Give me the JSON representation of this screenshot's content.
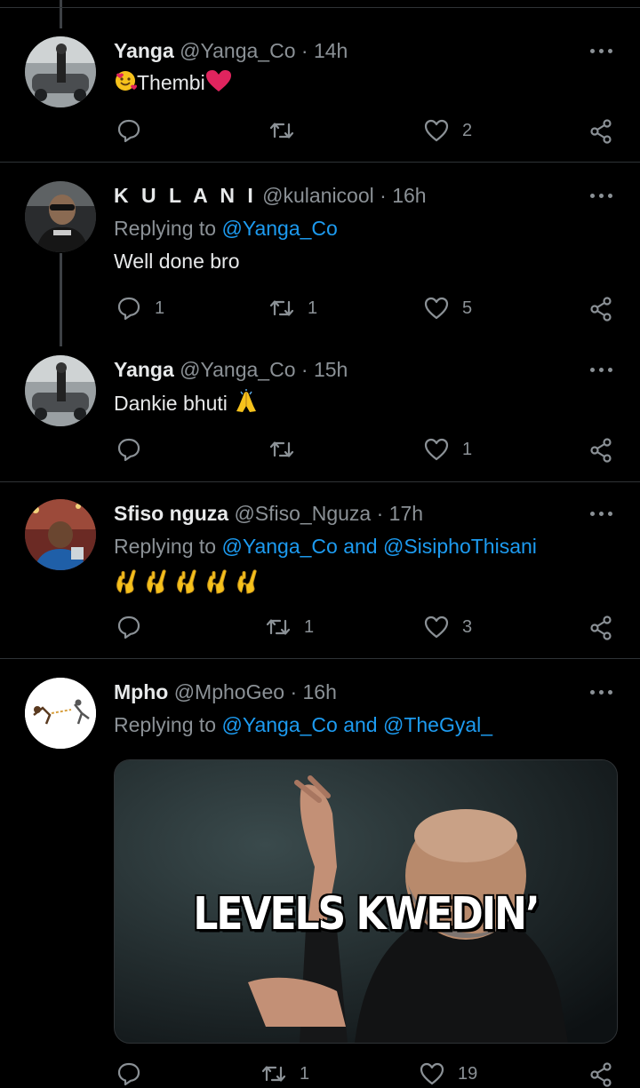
{
  "tweets": [
    {
      "name": "Yanga",
      "handle": "@Yanga_Co",
      "separator": "·",
      "time": "14h",
      "text": "Thembi",
      "leading_emoji": "smiling-face-with-hearts-icon",
      "trailing_emoji": "red-heart-icon",
      "replies": "",
      "retweets": "",
      "likes": "2"
    },
    {
      "name": "K U L A N I",
      "handle": "@kulanicool",
      "separator": "·",
      "time": "16h",
      "replying_prefix": "Replying to",
      "replying_to": [
        "@Yanga_Co"
      ],
      "text": "Well done bro",
      "replies": "1",
      "retweets": "1",
      "likes": "5"
    },
    {
      "name": "Yanga",
      "handle": "@Yanga_Co",
      "separator": "·",
      "time": "15h",
      "text": "Dankie bhuti",
      "trailing_emoji": "folded-hands-icon",
      "replies": "",
      "retweets": "",
      "likes": "1"
    },
    {
      "name": "Sfiso nguza",
      "handle": "@Sfiso_Nguza",
      "separator": "·",
      "time": "17h",
      "replying_prefix": "Replying to",
      "replying_to": [
        "@Yanga_Co",
        "@SisiphoThisani"
      ],
      "replying_conj": "and",
      "text_emoji": "ok-hand-icon x5",
      "replies": "",
      "retweets": "1",
      "likes": "3"
    },
    {
      "name": "Mpho",
      "handle": "@MphoGeo",
      "separator": "·",
      "time": "16h",
      "replying_prefix": "Replying to",
      "replying_to": [
        "@Yanga_Co",
        "@TheGyal_"
      ],
      "replying_conj": "and",
      "media_caption": "LEVELS KWEDIN’",
      "replies": "",
      "retweets": "1",
      "likes": "19"
    }
  ],
  "colors": {
    "background": "#000000",
    "text_primary": "#e7e9ea",
    "text_secondary": "#8b9196",
    "link": "#1d9bf0",
    "divider": "#2f3336"
  }
}
